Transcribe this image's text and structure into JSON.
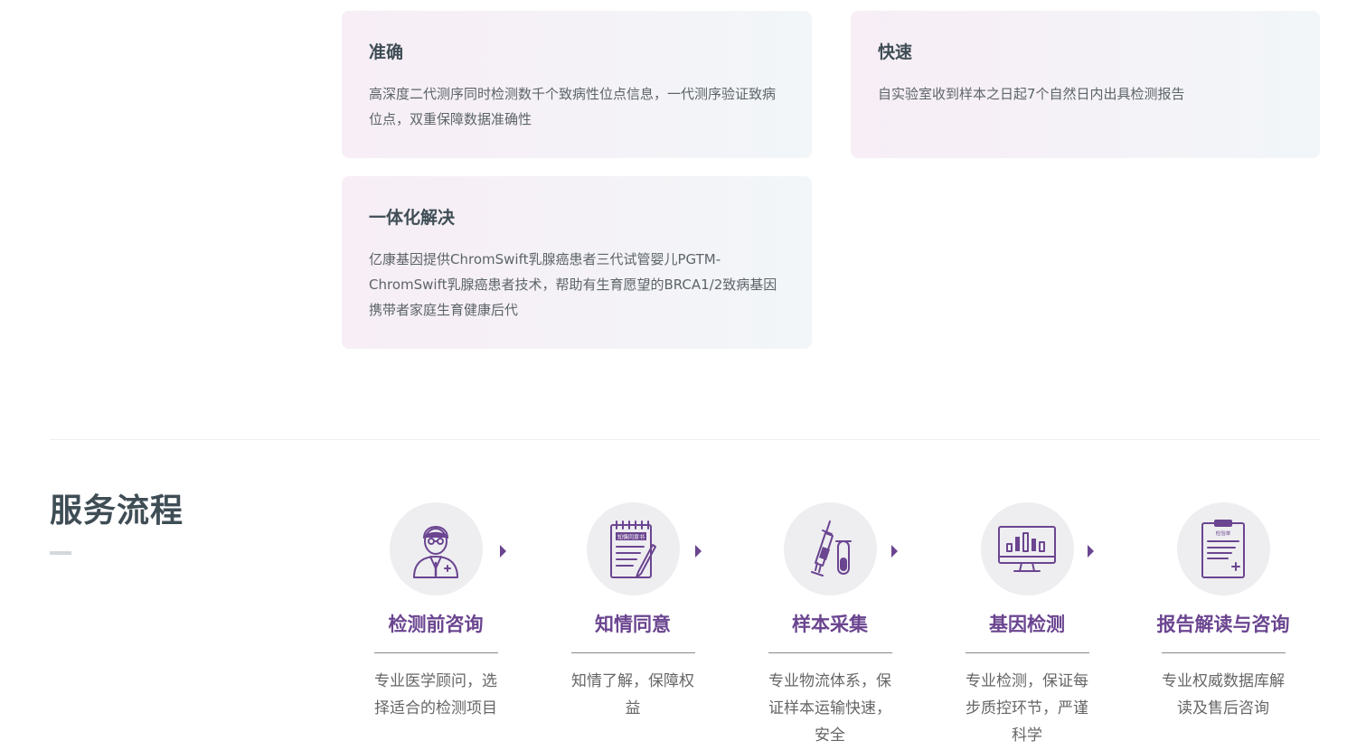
{
  "features": [
    {
      "title": "准确",
      "text": "高深度二代测序同时检测数千个致病性位点信息，一代测序验证致病位点，双重保障数据准确性"
    },
    {
      "title": "快速",
      "text": "自实验室收到样本之日起7个自然日内出具检测报告"
    },
    {
      "title": "一体化解决",
      "text": "亿康基因提供ChromSwift乳腺癌患者三代试管婴儿PGTM-ChromSwift乳腺癌患者技术，帮助有生育愿望的BRCA1/2致病基因携带者家庭生育健康后代"
    }
  ],
  "process": {
    "title": "服务流程",
    "steps": [
      {
        "icon": "doctor-icon",
        "label": "检测前咨询",
        "desc": "专业医学顾问，选择适合的检测项目"
      },
      {
        "icon": "consent-form-icon",
        "label": "知情同意",
        "desc": "知情了解，保障权益",
        "icon_text": "知情同意书"
      },
      {
        "icon": "syringe-tube-icon",
        "label": "样本采集",
        "desc": "专业物流体系，保证样本运输快速，安全"
      },
      {
        "icon": "monitor-chart-icon",
        "label": "基因检测",
        "desc": "专业检测，保证每步质控环节，严谨科学"
      },
      {
        "icon": "report-clipboard-icon",
        "label": "报告解读与咨询",
        "desc": "专业权威数据库解读及售后咨询",
        "icon_text": "检验单"
      }
    ]
  },
  "colors": {
    "accent": "#6b4590",
    "heading": "#3f4d55",
    "card_from": "#f7eef6",
    "card_to": "#f2f6f8"
  }
}
